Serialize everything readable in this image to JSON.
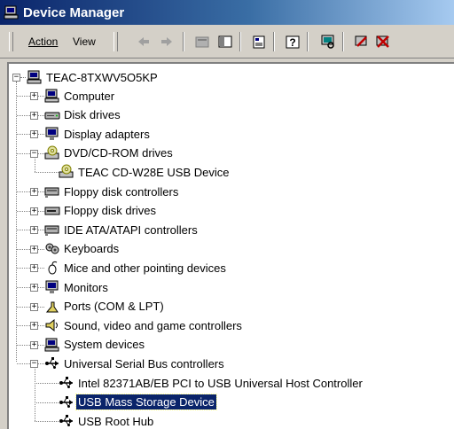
{
  "window": {
    "title": "Device Manager"
  },
  "menu": {
    "action_label": "Action",
    "view_label": "View"
  },
  "tree": {
    "root": "TEAC-8TXWV5O5KP",
    "items": [
      {
        "label": "Computer",
        "icon": "computer-icon",
        "expander": "+"
      },
      {
        "label": "Disk drives",
        "icon": "disk-drive-icon",
        "expander": "+"
      },
      {
        "label": "Display adapters",
        "icon": "monitor-icon",
        "expander": "+"
      },
      {
        "label": "DVD/CD-ROM drives",
        "icon": "cdrom-icon",
        "expander": "-"
      },
      {
        "label": "TEAC CD-W28E USB Device",
        "icon": "cdrom-icon",
        "child": true
      },
      {
        "label": "Floppy disk controllers",
        "icon": "controller-icon",
        "expander": "+"
      },
      {
        "label": "Floppy disk drives",
        "icon": "floppy-drive-icon",
        "expander": "+"
      },
      {
        "label": "IDE ATA/ATAPI controllers",
        "icon": "controller-icon",
        "expander": "+"
      },
      {
        "label": "Keyboards",
        "icon": "keyboard-icon",
        "expander": "+"
      },
      {
        "label": "Mice and other pointing devices",
        "icon": "mouse-icon",
        "expander": "+"
      },
      {
        "label": "Monitors",
        "icon": "monitor-icon",
        "expander": "+"
      },
      {
        "label": "Ports (COM & LPT)",
        "icon": "port-icon",
        "expander": "+"
      },
      {
        "label": "Sound, video and game controllers",
        "icon": "speaker-icon",
        "expander": "+"
      },
      {
        "label": "System devices",
        "icon": "computer-icon",
        "expander": "+"
      },
      {
        "label": "Universal Serial Bus controllers",
        "icon": "usb-icon",
        "expander": "-"
      },
      {
        "label": "Intel 82371AB/EB PCI to USB Universal Host Controller",
        "icon": "usb-icon",
        "child": true
      },
      {
        "label": "USB Mass Storage Device",
        "icon": "usb-icon",
        "child": true,
        "selected": true
      },
      {
        "label": "USB Root Hub",
        "icon": "usb-icon",
        "child": true
      }
    ]
  },
  "colors": {
    "title_bar": "#0a246a",
    "selection": "#0a246a",
    "face": "#d4d0c8"
  }
}
